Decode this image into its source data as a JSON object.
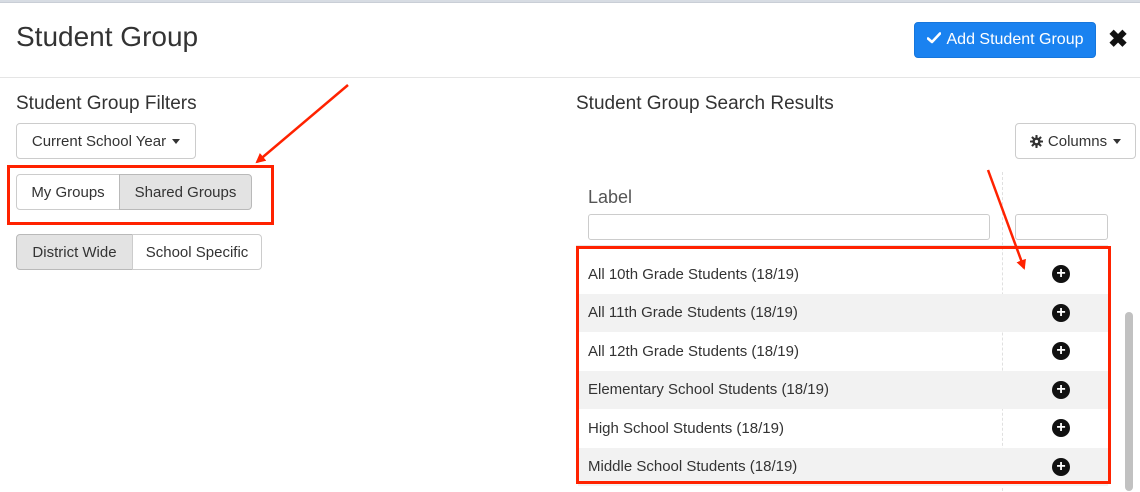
{
  "modal": {
    "title": "Student Group",
    "add_button_label": "Add Student Group",
    "add_button_icon": "check-icon",
    "close_icon": "close-icon",
    "close_glyph": "✖"
  },
  "filters": {
    "title": "Student Group Filters",
    "year_dropdown_label": "Current School Year",
    "ownership_toggle": [
      {
        "label": "My Groups",
        "active": false
      },
      {
        "label": "Shared Groups",
        "active": true
      }
    ],
    "scope_toggle": [
      {
        "label": "District Wide",
        "active": true
      },
      {
        "label": "School Specific",
        "active": false
      }
    ]
  },
  "results": {
    "title": "Student Group Search Results",
    "columns_button_label": "Columns",
    "columns_button_icon": "gear-icon",
    "column_header_label": "Label",
    "rows": [
      {
        "label": "All 10th Grade Students (18/19)"
      },
      {
        "label": "All 11th Grade Students (18/19)"
      },
      {
        "label": "All 12th Grade Students (18/19)"
      },
      {
        "label": "Elementary School Students (18/19)"
      },
      {
        "label": "High School Students (18/19)"
      },
      {
        "label": "Middle School Students (18/19)"
      }
    ],
    "add_row_icon": "plus-circle-icon"
  },
  "colors": {
    "primary": "#1a82f0",
    "annotation": "#ff2200",
    "active_toggle": "#e3e3e3"
  }
}
